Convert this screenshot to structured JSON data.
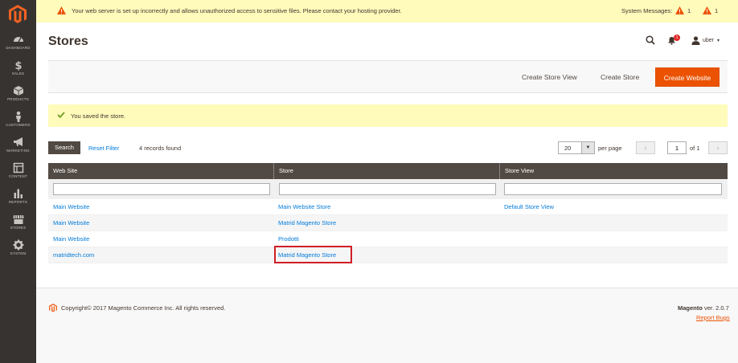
{
  "colors": {
    "sidebar": "#373330",
    "accent": "#eb5202",
    "link": "#007bdb",
    "notice": "#fffbbb",
    "grid_header": "#514943",
    "highlight": "#d11e25"
  },
  "sidebar": {
    "items": [
      {
        "label": "DASHBOARD",
        "icon": "dashboard-icon"
      },
      {
        "label": "SALES",
        "icon": "dollar-icon"
      },
      {
        "label": "PRODUCTS",
        "icon": "cube-icon"
      },
      {
        "label": "CUSTOMERS",
        "icon": "person-icon"
      },
      {
        "label": "MARKETING",
        "icon": "megaphone-icon"
      },
      {
        "label": "CONTENT",
        "icon": "layout-icon"
      },
      {
        "label": "REPORTS",
        "icon": "bar-chart-icon"
      },
      {
        "label": "STORES",
        "icon": "store-icon"
      },
      {
        "label": "SYSTEM",
        "icon": "gear-icon"
      }
    ]
  },
  "notice": {
    "message": "Your web server is set up incorrectly and allows unauthorized access to sensitive files. Please contact your hosting provider.",
    "system_messages_label": "System Messages:",
    "count_a": "1",
    "count_b": "1"
  },
  "header": {
    "title": "Stores",
    "notifications_count": "1",
    "user": "uber"
  },
  "actions": {
    "create_store_view": "Create Store View",
    "create_store": "Create Store",
    "create_website": "Create Website"
  },
  "success_message": "You saved the store.",
  "toolbar": {
    "search": "Search",
    "reset_filter": "Reset Filter",
    "records_found": "4 records found",
    "per_page_value": "20",
    "per_page_label": "per page",
    "prev": "‹",
    "page": "1",
    "of_label": "of 1",
    "next": "›"
  },
  "grid": {
    "columns": [
      "Web Site",
      "Store",
      "Store View"
    ],
    "rows": [
      [
        "Main Website",
        "Main Website Store",
        "Default Store View"
      ],
      [
        "Main Website",
        "Matrid Magento Store",
        ""
      ],
      [
        "Main Website",
        "Prodotti",
        ""
      ],
      [
        "matridtech.com",
        "Matrid Magento Store",
        ""
      ]
    ]
  },
  "footer": {
    "copyright": "Copyright© 2017 Magento Commerce Inc. All rights reserved.",
    "brand": "Magento",
    "version": "ver. 2.0.7",
    "report_bugs": "Report Bugs"
  }
}
